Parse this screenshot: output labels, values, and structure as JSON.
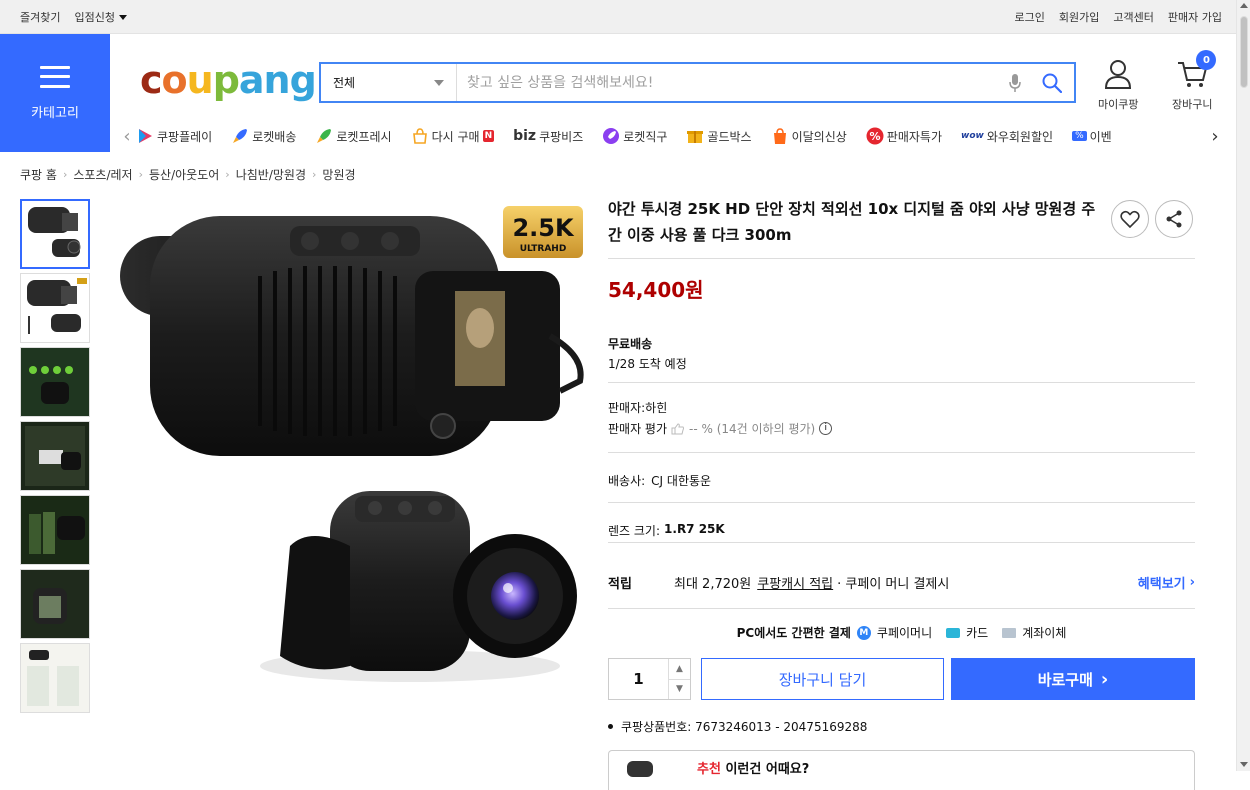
{
  "topbar": {
    "left": [
      "즐겨찾기",
      "입점신청"
    ],
    "right": [
      "로그인",
      "회원가입",
      "고객센터",
      "판매자 가입"
    ]
  },
  "header": {
    "category_label": "카테고리",
    "logo": [
      "c",
      "o",
      "u",
      "p",
      "ang"
    ],
    "search": {
      "category": "전체",
      "placeholder": "찾고 싶은 상품을 검색해보세요!"
    },
    "mypage_label": "마이쿠팡",
    "cart_label": "장바구니",
    "cart_count": "0"
  },
  "quick_menu": {
    "items": [
      {
        "label": "쿠팡플레이",
        "icon": "play-icon",
        "color": "#e53a67"
      },
      {
        "label": "로켓배송",
        "icon": "rocket-icon",
        "color": "#346aff"
      },
      {
        "label": "로켓프레시",
        "icon": "rocket-fresh-icon",
        "color": "#3bb54a"
      },
      {
        "label": "다시 구매",
        "icon": "rebuy-icon",
        "color": "#f5a623",
        "badge": "N"
      },
      {
        "label": "쿠팡비즈",
        "icon": "biz-icon",
        "prefix": "biz"
      },
      {
        "label": "로켓직구",
        "icon": "rocket-global-icon",
        "color": "#8b3ff0"
      },
      {
        "label": "골드박스",
        "icon": "goldbox-icon",
        "color": "#f2b31a"
      },
      {
        "label": "이달의신상",
        "icon": "new-icon",
        "color": "#ff6a1a"
      },
      {
        "label": "판매자특가",
        "icon": "percent-icon",
        "color": "#e5262f"
      },
      {
        "label": "와우회원할인",
        "icon": "wow-icon",
        "prefix": "wow"
      },
      {
        "label": "이벤",
        "icon": "event-icon",
        "prefix": "%"
      }
    ]
  },
  "breadcrumb": [
    "쿠팡 홈",
    "스포츠/레저",
    "등산/아웃도어",
    "나침반/망원경",
    "망원경"
  ],
  "product": {
    "title": "야간 투시경 25K HD 단안 장치 적외선 10x 디지털 줌 야외 사냥 망원경 주간 이중 사용 풀 다크 300m",
    "badge": "2.5K",
    "badge_sub": "ULTRAHD",
    "price": "54,400원",
    "shipping_label": "무료배송",
    "arrival": "1/28 도착 예정",
    "seller": "판매자:하힌",
    "seller_rating_label": "판매자 평가",
    "seller_rating_value": "-- % (14건 이하의 평가)",
    "carrier_label": "배송사:",
    "carrier": "CJ 대한통운",
    "option_label": "렌즈 크기:",
    "option_value": "1.R7 25K",
    "reward_label": "적립",
    "reward_text_1": "최대 2,720원",
    "reward_link": "쿠팡캐시 적립",
    "reward_text_2": "· 쿠페이 머니 결제시",
    "benefit_label": "혜택보기",
    "pay_intro": "PC에서도 간편한 결제",
    "pay_methods": [
      "쿠페이머니",
      "카드",
      "계좌이체"
    ],
    "quantity": "1",
    "cart_button": "장바구니 담기",
    "buy_button": "바로구매",
    "product_no": "쿠팡상품번호: 7673246013 - 20475169288",
    "rec_highlight": "추천",
    "rec_text": "이런건 어때요?"
  }
}
